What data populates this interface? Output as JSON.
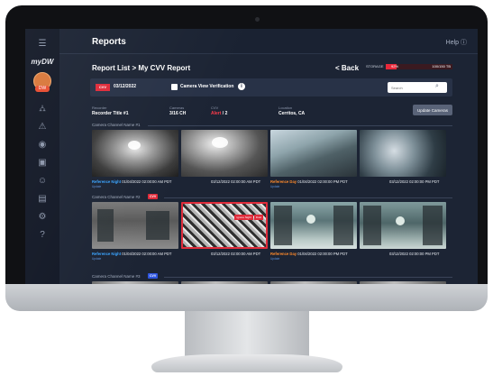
{
  "app": {
    "brand": "myDW",
    "page_title": "Reports",
    "help_label": "Help",
    "user_badge": "DW"
  },
  "sidebar": {
    "items": [
      {
        "icon": "menu-icon"
      },
      {
        "icon": "sitemap-icon"
      },
      {
        "icon": "warning-icon"
      },
      {
        "icon": "dvr-icon"
      },
      {
        "icon": "document-icon"
      },
      {
        "icon": "user-icon"
      },
      {
        "icon": "report-icon"
      },
      {
        "icon": "gear-icon"
      },
      {
        "icon": "help-icon"
      }
    ]
  },
  "header": {
    "breadcrumb": "Report List > My CVV Report",
    "back_label": "< Back",
    "storage_label": "STORAGE",
    "storage_percent": "92%",
    "storage_percent_value": 0.16,
    "storage_value": "100/150 TB"
  },
  "filter": {
    "cvv_badge": "CVV",
    "date": "03/12/2022",
    "checkbox_label": "Camera View Verification",
    "search_placeholder": "Search"
  },
  "recorder": {
    "recorder_label": "Recorder",
    "recorder_value": "Recorder Title #1",
    "cameras_label": "Cameras",
    "cameras_value": "3/16 CH",
    "cvv_label": "CVV",
    "cvv_alert": "Alert",
    "cvv_count": "/ 2",
    "location_label": "Location",
    "location_value": "Cerritos, CA",
    "update_button": "Update Cameras"
  },
  "channels": [
    {
      "title": "Camera Channel Name #1",
      "badge": "",
      "images": [
        {
          "caption_ref": "Reference Night",
          "caption_time": "01/04/2022 02:00:00 AM PDT",
          "sub": "Update"
        },
        {
          "caption_ref": "",
          "caption_time": "03/12/2022 02:00:00 AM PDT",
          "sub": ""
        },
        {
          "caption_ref": "Reference Day",
          "caption_time": "01/04/2022 02:00:00 PM PDT",
          "sub": "Update"
        },
        {
          "caption_ref": "",
          "caption_time": "03/12/2022 02:00:00 PM PDT",
          "sub": ""
        }
      ]
    },
    {
      "title": "Camera Channel Name #2",
      "badge": "CVV",
      "tags": [
        "Ignore Night",
        "Dust"
      ],
      "images": [
        {
          "caption_ref": "Reference Night",
          "caption_time": "01/04/2022 02:00:00 AM PDT",
          "sub": "Update"
        },
        {
          "caption_ref": "",
          "caption_time": "03/12/2022 02:00:00 AM PDT",
          "sub": ""
        },
        {
          "caption_ref": "Reference Day",
          "caption_time": "01/04/2022 02:00:00 PM PDT",
          "sub": "Update"
        },
        {
          "caption_ref": "",
          "caption_time": "03/12/2022 02:00:00 PM PDT",
          "sub": ""
        }
      ]
    },
    {
      "title": "Camera Channel Name #3",
      "badge": "CVV"
    }
  ],
  "colors": {
    "accent_red": "#e02b3a",
    "reference_night": "#3aa4ff",
    "reference_day": "#ff8a2b",
    "badge_blue": "#2f56e0"
  }
}
